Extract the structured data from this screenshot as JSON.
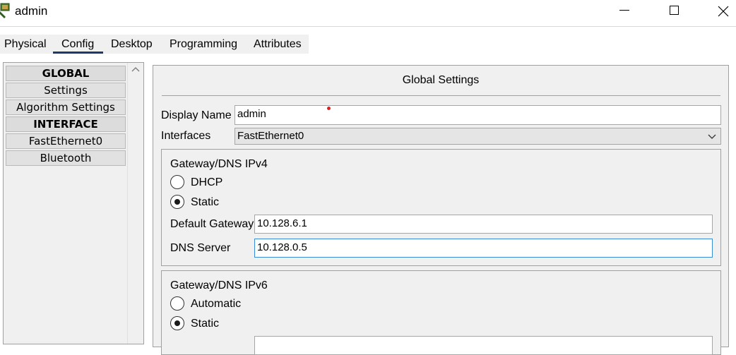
{
  "window": {
    "title": "admin",
    "minimize_icon": "minimize-icon",
    "maximize_icon": "maximize-icon",
    "close_label": "✕"
  },
  "tabs": [
    {
      "label": "Physical"
    },
    {
      "label": "Config",
      "active": true
    },
    {
      "label": "Desktop"
    },
    {
      "label": "Programming"
    },
    {
      "label": "Attributes"
    }
  ],
  "sidebar": {
    "items": [
      {
        "label": "GLOBAL",
        "header": true
      },
      {
        "label": "Settings"
      },
      {
        "label": "Algorithm Settings"
      },
      {
        "label": "INTERFACE",
        "header": true
      },
      {
        "label": "FastEthernet0"
      },
      {
        "label": "Bluetooth"
      }
    ]
  },
  "main": {
    "title": "Global Settings",
    "display_name_label": "Display Name",
    "display_name_value": "admin",
    "interfaces_label": "Interfaces",
    "interfaces_value": "FastEthernet0",
    "ipv4": {
      "title": "Gateway/DNS IPv4",
      "dhcp_label": "DHCP",
      "static_label": "Static",
      "selected": "Static",
      "gateway_label": "Default Gateway",
      "gateway_value": "10.128.6.1",
      "dns_label": "DNS Server",
      "dns_value": "10.128.0.5"
    },
    "ipv6": {
      "title": "Gateway/DNS IPv6",
      "automatic_label": "Automatic",
      "static_label": "Static",
      "selected": "Static",
      "gateway_value": ""
    }
  },
  "colors": {
    "tab_underline": "#1b3a6e",
    "focus_border": "#3a8cd4",
    "panel_bg": "#f0f0f0"
  }
}
